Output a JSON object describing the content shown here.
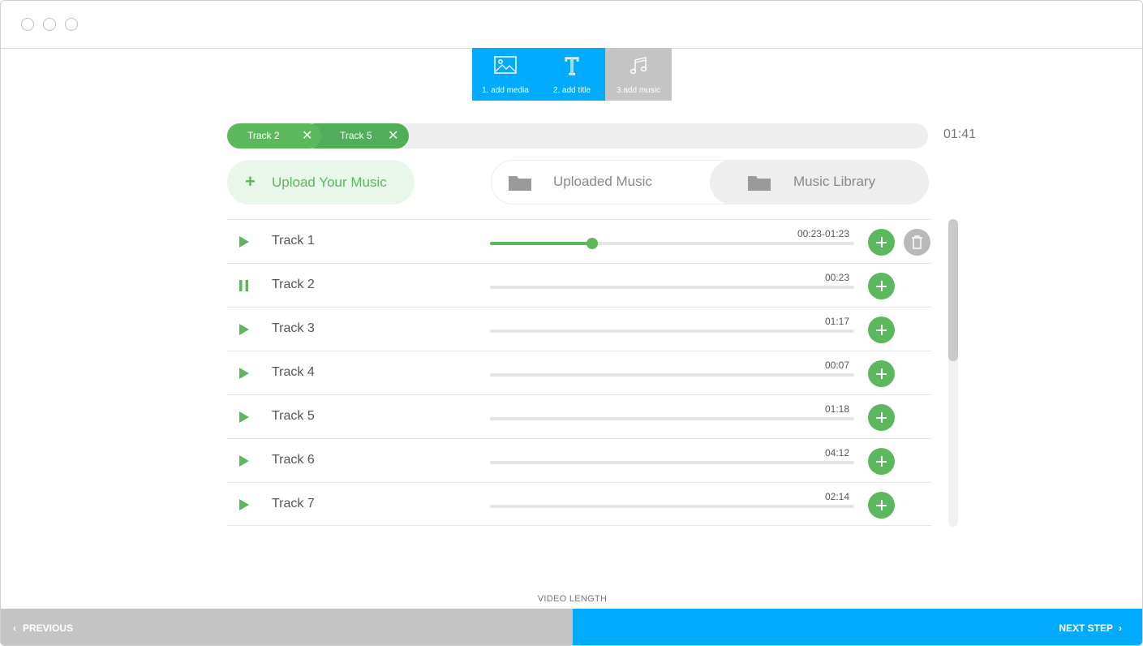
{
  "steps": [
    {
      "label": "1. add media",
      "icon": "image-icon"
    },
    {
      "label": "2. add title",
      "icon": "text-icon"
    },
    {
      "label": "3.add music",
      "icon": "music-note-icon"
    }
  ],
  "selected_tracks": [
    {
      "label": "Track 2"
    },
    {
      "label": "Track 5"
    }
  ],
  "total_duration": "01:41",
  "upload_button": {
    "plus": "+",
    "label": "Upload Your Music"
  },
  "tabs": [
    {
      "label": "Uploaded Music",
      "icon": "folder-icon"
    },
    {
      "label": "Music Library",
      "icon": "folder-icon"
    }
  ],
  "tracks": [
    {
      "name": "Track 1",
      "time": "00:23-01:23",
      "state": "play",
      "progress": 0.28
    },
    {
      "name": "Track 2",
      "time": "00:23",
      "state": "pause"
    },
    {
      "name": "Track 3",
      "time": "01:17",
      "state": "play"
    },
    {
      "name": "Track 4",
      "time": "00:07",
      "state": "play"
    },
    {
      "name": "Track 5",
      "time": "01:18",
      "state": "play"
    },
    {
      "name": "Track 6",
      "time": "04:12",
      "state": "play"
    },
    {
      "name": "Track 7",
      "time": "02:14",
      "state": "play"
    }
  ],
  "footer": {
    "video_length_label": "VIDEO LENGTH",
    "previous_label": "PREVIOUS",
    "next_label": "NEXT STEP"
  },
  "colors": {
    "accent": "#00aaff",
    "green": "#5cb85c",
    "inactive": "#c4c4c4"
  }
}
